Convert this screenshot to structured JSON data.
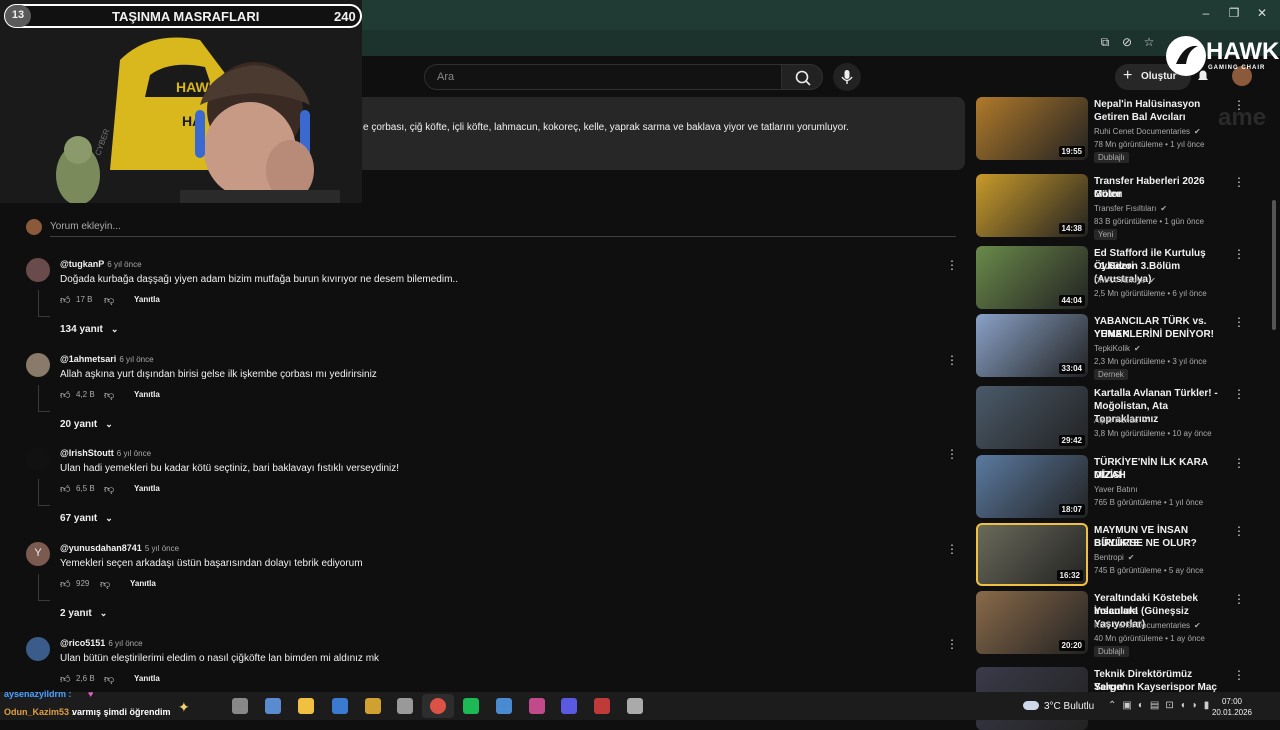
{
  "browser": {
    "window_controls": [
      "–",
      "❐",
      "✕"
    ]
  },
  "youtube": {
    "search_placeholder": "Ara",
    "create_label": "Oluştur",
    "description": "e çorbası, çiğ köfte, içli köfte, lahmacun, kokoreç, kelle, yaprak sarma ve baklava yiyor ve tatlarını yorumluyor."
  },
  "webcam": {
    "number": "13",
    "title": "TAŞINMA MASRAFLARI",
    "count": "240",
    "chair_brand": "HAWK",
    "chair_brand2": "HA",
    "chair_model": "CYBER"
  },
  "overlay_logo": {
    "brand": "HAWK",
    "sub": "GAMING CHAIR",
    "ghost": "ame"
  },
  "comments": {
    "add_placeholder": "Yorum ekleyin...",
    "items": [
      {
        "author": "@tugkanP",
        "time": "6 yıl önce",
        "text": "Doğada kurbağa daşşağı yiyen adam bizim mutfağa burun kıvırıyor ne desem bilemedim..",
        "likes": "17 B",
        "reply": "Yanıtla",
        "replies": "134 yanıt",
        "avatar_color": "#6a4b4b"
      },
      {
        "author": "@1ahmetsari",
        "time": "6 yıl önce",
        "text": "Allah aşkına yurt dışından birisi gelse ilk  işkembe çorbası mı yedirirsiniz",
        "likes": "4,2 B",
        "reply": "Yanıtla",
        "replies": "20 yanıt",
        "avatar_color": "#8a7a6a"
      },
      {
        "author": "@IrishStoutt",
        "time": "6 yıl önce",
        "text": "Ulan hadi yemekleri bu kadar kötü seçtiniz, bari baklavayı fıstıklı verseydiniz!",
        "likes": "6,5 B",
        "reply": "Yanıtla",
        "replies": "67 yanıt",
        "avatar_color": "#111111"
      },
      {
        "author": "@yunusdahan8741",
        "time": "5 yıl önce",
        "text": "Yemekleri seçen arkadaşı üstün başarısından dolayı tebrik ediyorum",
        "likes": "929",
        "reply": "Yanıtla",
        "replies": "2 yanıt",
        "avatar_color": "#7b5a4f",
        "avatar_letter": "Y"
      },
      {
        "author": "@rico5151",
        "time": "6 yıl önce",
        "text": "Ulan bütün eleştirilerimi eledim o nasıl çiğköfte lan bimden mi aldınız mk",
        "likes": "2,6 B",
        "reply": "Yanıtla",
        "replies": "",
        "avatar_color": "#3b5b8a"
      }
    ]
  },
  "sidebar": [
    {
      "title_lines": [
        "Nepal'in Halüsinasyon",
        "Getiren Bal Avcıları"
      ],
      "channel": "Ruhi Cenet Documentaries",
      "meta": "78 Mn görüntüleme  •  1 yıl önce",
      "badge": "Dublajlı",
      "duration": "19:55",
      "thumb": "#b07a2a",
      "verified": true
    },
    {
      "title_lines": [
        "Transfer Haberleri 2026 Gülen",
        "Motor"
      ],
      "channel": "Transfer Fısıltıları",
      "meta": "83 B görüntüleme  •  1 gün önce",
      "badge": "Yeni",
      "duration": "14:38",
      "thumb": "#c89a2a",
      "verified": true
    },
    {
      "title_lines": [
        "Ed Stafford ile Kurtuluş Öyküleri",
        "- 1.Sezon 3.Bölüm (Avustralya)"
      ],
      "channel": "DMAX Turkiye",
      "meta": "2,5 Mn görüntüleme  •  6 yıl önce",
      "badge": "",
      "duration": "44:04",
      "thumb": "#6a8a4a",
      "verified": true
    },
    {
      "title_lines": [
        "YABANCILAR TÜRK vs. YUNAN",
        "YEMEKLERİNİ DENİYOR!"
      ],
      "channel": "TepkiKolik",
      "meta": "2,3 Mn görüntüleme  •  3 yıl önce",
      "badge": "Dernek",
      "duration": "33:04",
      "thumb": "#8aa2c8",
      "verified": true
    },
    {
      "title_lines": [
        "Kartalla Avlanan Türkler! -",
        "Moğolistan, Ata Topraklarımız"
      ],
      "channel": "Alper Rende",
      "meta": "3,8 Mn görüntüleme  •  10 ay önce",
      "badge": "",
      "duration": "29:42",
      "thumb": "#4a5a6a",
      "verified": true
    },
    {
      "title_lines": [
        "TÜRKİYE'NİN İLK KARA MİZAH",
        "DİZİSİ"
      ],
      "channel": "Yaver Batını",
      "meta": "765 B görüntüleme  •  1 yıl önce",
      "badge": "",
      "duration": "18:07",
      "thumb": "#5a7aa0",
      "verified": false
    },
    {
      "title_lines": [
        "MAYMUN VE İNSAN BİRLİKTE",
        "BÜYÜRSE NE OLUR?"
      ],
      "channel": "Bentropi",
      "meta": "745 B görüntüleme  •  5 ay önce",
      "badge": "",
      "duration": "16:32",
      "thumb": "#6a6a5a",
      "verified": true
    },
    {
      "title_lines": [
        "Yeraltındaki Köstebek İnsanlara",
        "Yolculuk! (Güneşsiz Yaşıyorlar)"
      ],
      "channel": "Ruhi Cenet Documentaries",
      "meta": "40 Mn görüntüleme  •  1 ay önce",
      "badge": "Dublajlı",
      "duration": "20:20",
      "thumb": "#8a6a4a",
      "verified": true
    },
    {
      "title_lines": [
        "Teknik Direktörümüz Sergen",
        "Yalçın'ın Kayserispor Maç Son..."
      ],
      "channel": "",
      "meta": "",
      "badge": "",
      "duration": "",
      "thumb": "#3a3a4a",
      "verified": false
    }
  ],
  "taskbar": {
    "chat_user1": "aysenazyildrm :",
    "chat_user2": "Odun_Kazim53 :",
    "chat_msg": "varmış şimdi öğrendim",
    "weather": "3°C  Bulutlu",
    "time": "07:00",
    "date": "20.01.2026",
    "icon_colors": [
      "#5a8ad0",
      "#f0c040",
      "#3a7ad0",
      "#d0a030",
      "#999999",
      "#db4437",
      "#1db954",
      "#4a8ad0",
      "#c04a8a",
      "#5a5ae0",
      "#c03a3a",
      "#aaaaaa"
    ]
  }
}
